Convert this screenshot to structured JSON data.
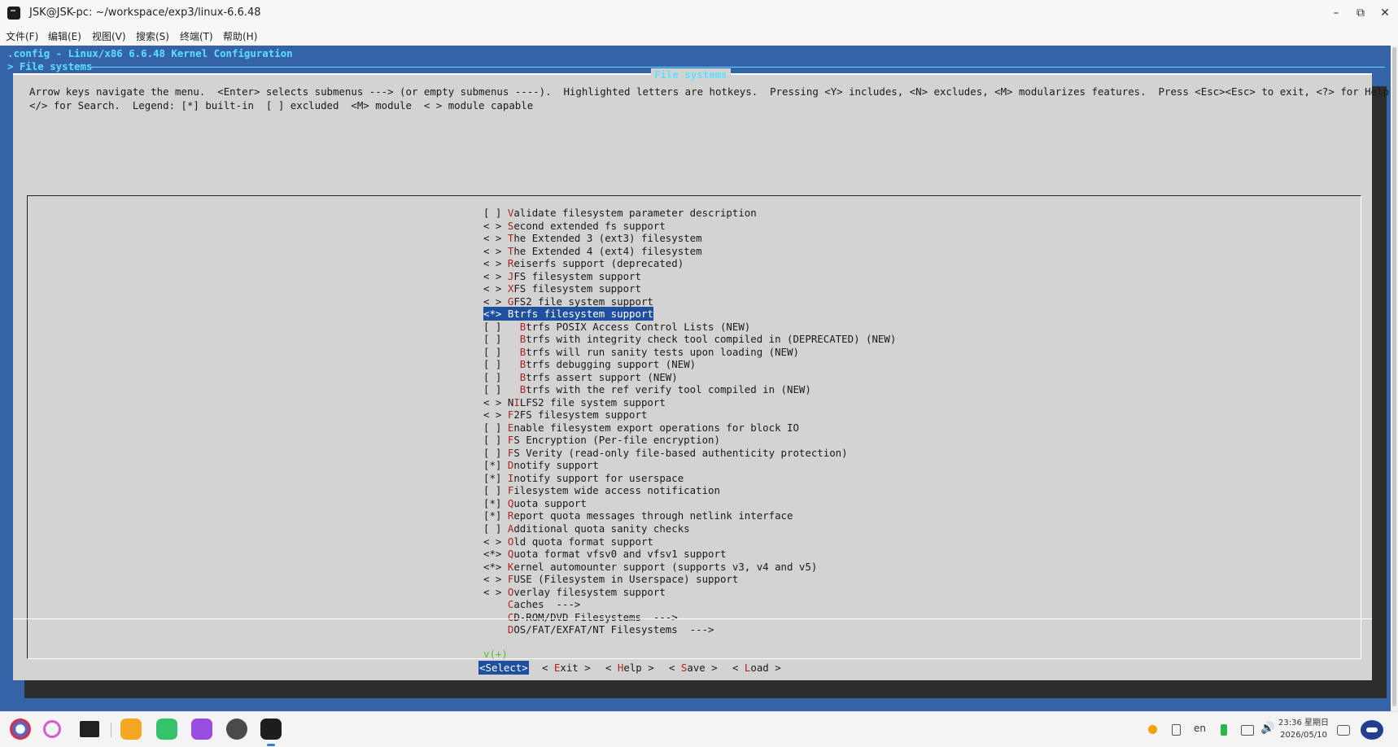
{
  "window": {
    "title": "JSK@JSK-pc: ~/workspace/exp3/linux-6.6.48",
    "minimize_glyph": "–",
    "restore_glyph": "⧉",
    "close_glyph": "✕"
  },
  "menubar": {
    "items": [
      "文件(F)",
      "编辑(E)",
      "视图(V)",
      "搜索(S)",
      "终端(T)",
      "帮助(H)"
    ]
  },
  "terminal": {
    "config_line": ".config - Linux/x86 6.6.48 Kernel Configuration",
    "breadcrumb": "> File systems",
    "dialog_title": "File systems",
    "help_lines": [
      "Arrow keys navigate the menu.  <Enter> selects submenus ---> (or empty submenus ----).  Highlighted letters are hotkeys.  Pressing <Y> includes, <N> excludes, <M> modularizes features.  Press <Esc><Esc> to exit, <?> for Help,",
      "</> for Search.  Legend: [*] built-in  [ ] excluded  <M> module  < > module capable"
    ],
    "items": [
      {
        "prefix": "[ ] ",
        "hotkey": "V",
        "rest": "alidate filesystem parameter description",
        "selected": false
      },
      {
        "prefix": "< > ",
        "hotkey": "S",
        "rest": "econd extended fs support",
        "selected": false
      },
      {
        "prefix": "< > ",
        "hotkey": "T",
        "rest": "he Extended 3 (ext3) filesystem",
        "selected": false
      },
      {
        "prefix": "< > ",
        "hotkey": "T",
        "rest": "he Extended 4 (ext4) filesystem",
        "selected": false
      },
      {
        "prefix": "< > ",
        "hotkey": "R",
        "rest": "eiserfs support (deprecated)",
        "selected": false
      },
      {
        "prefix": "< > ",
        "hotkey": "J",
        "rest": "FS filesystem support",
        "selected": false
      },
      {
        "prefix": "< > ",
        "hotkey": "X",
        "rest": "FS filesystem support",
        "selected": false
      },
      {
        "prefix": "< > ",
        "hotkey": "G",
        "rest": "FS2 file system support",
        "selected": false
      },
      {
        "prefix": "<*> ",
        "hotkey": "B",
        "rest": "trfs filesystem support",
        "selected": true
      },
      {
        "prefix": "[ ]   ",
        "hotkey": "B",
        "rest": "trfs POSIX Access Control Lists (NEW)",
        "selected": false
      },
      {
        "prefix": "[ ]   ",
        "hotkey": "B",
        "rest": "trfs with integrity check tool compiled in (DEPRECATED) (NEW)",
        "selected": false
      },
      {
        "prefix": "[ ]   ",
        "hotkey": "B",
        "rest": "trfs will run sanity tests upon loading (NEW)",
        "selected": false
      },
      {
        "prefix": "[ ]   ",
        "hotkey": "B",
        "rest": "trfs debugging support (NEW)",
        "selected": false
      },
      {
        "prefix": "[ ]   ",
        "hotkey": "B",
        "rest": "trfs assert support (NEW)",
        "selected": false
      },
      {
        "prefix": "[ ]   ",
        "hotkey": "B",
        "rest": "trfs with the ref verify tool compiled in (NEW)",
        "selected": false
      },
      {
        "prefix": "< > N",
        "hotkey": "I",
        "rest": "LFS2 file system support",
        "selected": false
      },
      {
        "prefix": "< > ",
        "hotkey": "F",
        "rest": "2FS filesystem support",
        "selected": false
      },
      {
        "prefix": "[ ] ",
        "hotkey": "E",
        "rest": "nable filesystem export operations for block IO",
        "selected": false
      },
      {
        "prefix": "[ ] ",
        "hotkey": "F",
        "rest": "S Encryption (Per-file encryption)",
        "selected": false
      },
      {
        "prefix": "[ ] ",
        "hotkey": "F",
        "rest": "S Verity (read-only file-based authenticity protection)",
        "selected": false
      },
      {
        "prefix": "[*] ",
        "hotkey": "D",
        "rest": "notify support",
        "selected": false
      },
      {
        "prefix": "[*] ",
        "hotkey": "I",
        "rest": "notify support for userspace",
        "selected": false
      },
      {
        "prefix": "[ ] ",
        "hotkey": "F",
        "rest": "ilesystem wide access notification",
        "selected": false
      },
      {
        "prefix": "[*] ",
        "hotkey": "Q",
        "rest": "uota support",
        "selected": false
      },
      {
        "prefix": "[*] ",
        "hotkey": "R",
        "rest": "eport quota messages through netlink interface",
        "selected": false
      },
      {
        "prefix": "[ ] ",
        "hotkey": "A",
        "rest": "dditional quota sanity checks",
        "selected": false
      },
      {
        "prefix": "< > ",
        "hotkey": "O",
        "rest": "ld quota format support",
        "selected": false
      },
      {
        "prefix": "<*> ",
        "hotkey": "Q",
        "rest": "uota format vfsv0 and vfsv1 support",
        "selected": false
      },
      {
        "prefix": "<*> ",
        "hotkey": "K",
        "rest": "ernel automounter support (supports v3, v4 and v5)",
        "selected": false
      },
      {
        "prefix": "< > ",
        "hotkey": "F",
        "rest": "USE (Filesystem in Userspace) support",
        "selected": false
      },
      {
        "prefix": "< > ",
        "hotkey": "O",
        "rest": "verlay filesystem support",
        "selected": false
      },
      {
        "prefix": "    ",
        "hotkey": "C",
        "rest": "aches  --->",
        "selected": false
      },
      {
        "prefix": "    ",
        "hotkey": "C",
        "rest": "D-ROM/DVD Filesystems  --->",
        "selected": false
      },
      {
        "prefix": "    ",
        "hotkey": "D",
        "rest": "OS/FAT/EXFAT/NT Filesystems  --->",
        "selected": false
      }
    ],
    "more_indicator": "v(+)",
    "buttons": [
      {
        "pre": "<",
        "hotkey": "S",
        "rest": "elect>",
        "selected": true
      },
      {
        "pre": "< ",
        "hotkey": "E",
        "rest": "xit >",
        "selected": false
      },
      {
        "pre": "< ",
        "hotkey": "H",
        "rest": "elp >",
        "selected": false
      },
      {
        "pre": "< ",
        "hotkey": "S",
        "rest": "ave >",
        "selected": false
      },
      {
        "pre": "< ",
        "hotkey": "L",
        "rest": "oad >",
        "selected": false
      }
    ]
  },
  "taskbar": {
    "apps": [
      "launcher-icon",
      "search-icon",
      "multitask-icon",
      "files-icon",
      "chat-icon",
      "camera-icon",
      "settings-icon",
      "terminal-icon"
    ],
    "tray": {
      "lang": "en",
      "volume_glyph": "🔊",
      "time": "23:36 星期日",
      "date": "2026/05/10"
    }
  },
  "colors": {
    "terminal_bg": "#3563a8",
    "dialog_bg": "#d3d3d3",
    "title_cyan": "#5be1ff",
    "hotkey_red": "#b02020",
    "selected_bg": "#1f4f9f",
    "more_green": "#49c32c"
  }
}
